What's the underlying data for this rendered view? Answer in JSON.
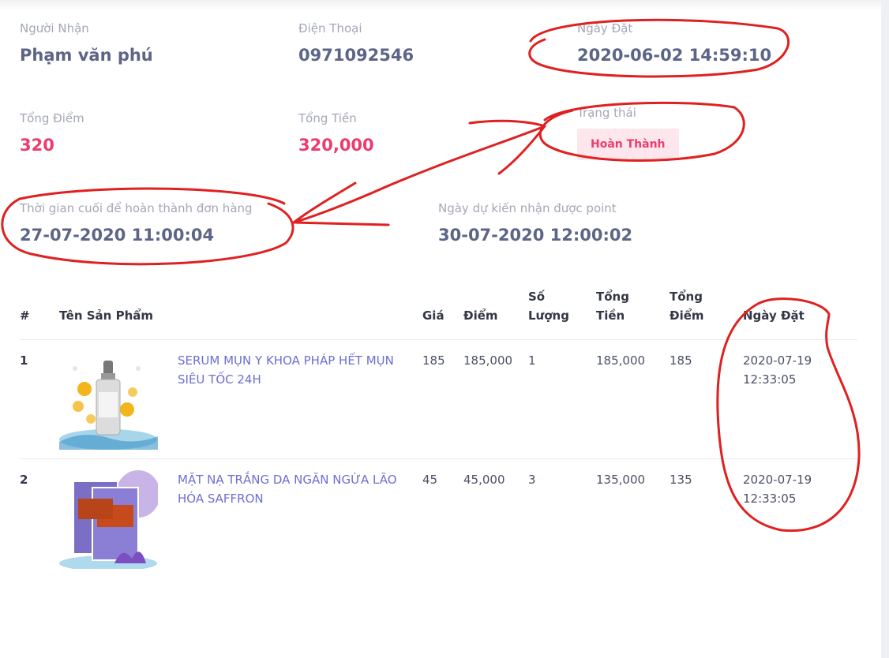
{
  "order": {
    "recipient": {
      "label": "Người Nhận",
      "value": "Phạm văn phú"
    },
    "phone": {
      "label": "Điện Thoại",
      "value": "0971092546"
    },
    "order_date": {
      "label": "Ngày Đặt",
      "value": "2020-06-02 14:59:10"
    },
    "total_points": {
      "label": "Tổng Điểm",
      "value": "320"
    },
    "total_amount": {
      "label": "Tổng Tiền",
      "value": "320,000"
    },
    "status": {
      "label": "Trạng thái",
      "value": "Hoàn Thành"
    },
    "deadline": {
      "label": "Thời gian cuối để hoàn thành đơn hàng",
      "value": "27-07-2020 11:00:04"
    },
    "expected_point_date": {
      "label": "Ngày dự kiến nhận được point",
      "value": "30-07-2020 12:00:02"
    }
  },
  "table": {
    "headers": {
      "index": "#",
      "product": "Tên Sản Phẩm",
      "price": "Giá",
      "points": "Điểm",
      "qty_1": "Số",
      "qty_2": "Lượng",
      "total_1": "Tổng",
      "total_2": "Tiền",
      "tpoints_1": "Tổng",
      "tpoints_2": "Điểm",
      "date": "Ngày Đặt"
    },
    "rows": [
      {
        "index": "1",
        "name": "SERUM MỤN Y KHOA PHÁP HẾT MỤN SIÊU TỐC 24H",
        "price": "185",
        "points": "185,000",
        "qty": "1",
        "total": "185,000",
        "tpoints": "185",
        "date_1": "2020-07-19",
        "date_2": "12:33:05"
      },
      {
        "index": "2",
        "name": "MẶT NẠ TRẮNG DA NGĂN NGỪA LÃO HÓA SAFFRON",
        "price": "45",
        "points": "45,000",
        "qty": "3",
        "total": "135,000",
        "tpoints": "135",
        "date_1": "2020-07-19",
        "date_2": "12:33:05"
      }
    ]
  },
  "colors": {
    "accent": "#ec3b6d",
    "value_text": "#5d6587",
    "link": "#6c6fd1",
    "annotation": "#e02020"
  }
}
